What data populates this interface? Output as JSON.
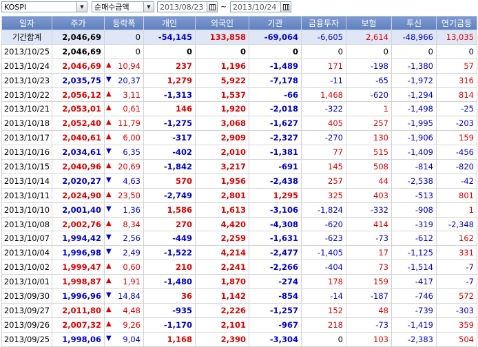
{
  "toolbar": {
    "market": "KOSPI",
    "metric": "순매수금액",
    "date_from": "2013/08/23",
    "date_to": "2013/10/24",
    "separator": "~"
  },
  "columns": [
    "일자",
    "주가",
    "등락폭",
    "개인",
    "외국인",
    "기관",
    "금융투자",
    "보험",
    "투신",
    "연기금등"
  ],
  "total_row": {
    "date": "기간합계",
    "price": "2,046,69",
    "change": "0",
    "individual": "-54,145",
    "foreign": "133,858",
    "institution": "-69,064",
    "fin_invest": "-6,605",
    "insurance": "2,614",
    "trust": "-48,966",
    "pension": "13,035"
  },
  "rows": [
    {
      "date": "2013/10/25",
      "price": "2,046,69",
      "dir": "flat",
      "change": "0",
      "individual": "0",
      "foreign": "0",
      "institution": "0",
      "fin_invest": "0",
      "insurance": "0",
      "trust": "0",
      "pension": "0"
    },
    {
      "date": "2013/10/24",
      "price": "2,046,69",
      "dir": "up",
      "change": "10,94",
      "individual": "237",
      "foreign": "1,196",
      "institution": "-1,489",
      "fin_invest": "171",
      "insurance": "-198",
      "trust": "-1,380",
      "pension": "57"
    },
    {
      "date": "2013/10/23",
      "price": "2,035,75",
      "dir": "down",
      "change": "20,37",
      "individual": "1,279",
      "foreign": "5,922",
      "institution": "-7,178",
      "fin_invest": "-11",
      "insurance": "-65",
      "trust": "-1,972",
      "pension": "316"
    },
    {
      "date": "2013/10/22",
      "price": "2,056,12",
      "dir": "up",
      "change": "3,11",
      "individual": "-1,313",
      "foreign": "1,537",
      "institution": "-66",
      "fin_invest": "1,468",
      "insurance": "-620",
      "trust": "-1,294",
      "pension": "814"
    },
    {
      "date": "2013/10/21",
      "price": "2,053,01",
      "dir": "up",
      "change": "0,61",
      "individual": "146",
      "foreign": "1,920",
      "institution": "-2,018",
      "fin_invest": "-322",
      "insurance": "1",
      "trust": "-1,498",
      "pension": "-25"
    },
    {
      "date": "2013/10/18",
      "price": "2,052,40",
      "dir": "up",
      "change": "11,79",
      "individual": "-1,275",
      "foreign": "3,068",
      "institution": "-1,627",
      "fin_invest": "405",
      "insurance": "257",
      "trust": "-1,995",
      "pension": "-203"
    },
    {
      "date": "2013/10/17",
      "price": "2,040,61",
      "dir": "up",
      "change": "6,00",
      "individual": "-317",
      "foreign": "2,909",
      "institution": "-2,327",
      "fin_invest": "-270",
      "insurance": "130",
      "trust": "-1,906",
      "pension": "159"
    },
    {
      "date": "2013/10/16",
      "price": "2,034,61",
      "dir": "down",
      "change": "6,35",
      "individual": "-402",
      "foreign": "2,010",
      "institution": "-1,381",
      "fin_invest": "77",
      "insurance": "515",
      "trust": "-1,409",
      "pension": "-456"
    },
    {
      "date": "2013/10/15",
      "price": "2,040,96",
      "dir": "up",
      "change": "20,69",
      "individual": "-1,842",
      "foreign": "3,217",
      "institution": "-691",
      "fin_invest": "145",
      "insurance": "508",
      "trust": "-814",
      "pension": "-820"
    },
    {
      "date": "2013/10/14",
      "price": "2,020,27",
      "dir": "down",
      "change": "4,63",
      "individual": "570",
      "foreign": "1,956",
      "institution": "-2,438",
      "fin_invest": "257",
      "insurance": "44",
      "trust": "-2,538",
      "pension": "-42"
    },
    {
      "date": "2013/10/11",
      "price": "2,024,90",
      "dir": "up",
      "change": "23,50",
      "individual": "-2,749",
      "foreign": "2,801",
      "institution": "1,295",
      "fin_invest": "325",
      "insurance": "403",
      "trust": "-513",
      "pension": "801"
    },
    {
      "date": "2013/10/10",
      "price": "2,001,40",
      "dir": "down",
      "change": "1,36",
      "individual": "1,586",
      "foreign": "1,613",
      "institution": "-3,106",
      "fin_invest": "-1,824",
      "insurance": "-332",
      "trust": "-908",
      "pension": "1"
    },
    {
      "date": "2013/10/08",
      "price": "2,002,76",
      "dir": "up",
      "change": "8,34",
      "individual": "270",
      "foreign": "4,420",
      "institution": "-4,308",
      "fin_invest": "-620",
      "insurance": "414",
      "trust": "-319",
      "pension": "-2,348"
    },
    {
      "date": "2013/10/07",
      "price": "1,994,42",
      "dir": "down",
      "change": "2,56",
      "individual": "-449",
      "foreign": "2,259",
      "institution": "-1,631",
      "fin_invest": "-623",
      "insurance": "-73",
      "trust": "-612",
      "pension": "162"
    },
    {
      "date": "2013/10/04",
      "price": "1,996,98",
      "dir": "down",
      "change": "2,49",
      "individual": "-1,522",
      "foreign": "4,214",
      "institution": "-2,477",
      "fin_invest": "-1,405",
      "insurance": "17",
      "trust": "-1,125",
      "pension": "331"
    },
    {
      "date": "2013/10/02",
      "price": "1,999,47",
      "dir": "up",
      "change": "0,60",
      "individual": "210",
      "foreign": "2,241",
      "institution": "-2,266",
      "fin_invest": "-404",
      "insurance": "73",
      "trust": "-1,514",
      "pension": "-7"
    },
    {
      "date": "2013/10/01",
      "price": "1,998,87",
      "dir": "up",
      "change": "1,91",
      "individual": "-1,480",
      "foreign": "1,870",
      "institution": "-274",
      "fin_invest": "178",
      "insurance": "159",
      "trust": "-417",
      "pension": "-7"
    },
    {
      "date": "2013/09/30",
      "price": "1,996,96",
      "dir": "down",
      "change": "14,84",
      "individual": "36",
      "foreign": "1,142",
      "institution": "-854",
      "fin_invest": "-14",
      "insurance": "-187",
      "trust": "-746",
      "pension": "572"
    },
    {
      "date": "2013/09/27",
      "price": "2,011,80",
      "dir": "up",
      "change": "4,48",
      "individual": "-935",
      "foreign": "2,226",
      "institution": "-1,257",
      "fin_invest": "152",
      "insurance": "48",
      "trust": "-739",
      "pension": "-303"
    },
    {
      "date": "2013/09/26",
      "price": "2,007,32",
      "dir": "up",
      "change": "9,26",
      "individual": "-1,170",
      "foreign": "2,101",
      "institution": "-967",
      "fin_invest": "218",
      "insurance": "-73",
      "trust": "-1,419",
      "pension": "359"
    },
    {
      "date": "2013/09/25",
      "price": "1,998,06",
      "dir": "down",
      "change": "9,04",
      "individual": "1,168",
      "foreign": "2,390",
      "institution": "-3,304",
      "fin_invest": "0",
      "insurance": "103",
      "trust": "-2,383",
      "pension": "504"
    }
  ],
  "colors": {
    "up": "#e00000",
    "down": "#0000cc",
    "header": "#6f8cc7",
    "total_bg": "#dfe7f6"
  },
  "icons": {
    "dropdown": "chevron-down-icon",
    "calendar": "calendar-icon",
    "up": "triangle-up-icon",
    "down": "triangle-down-icon"
  }
}
